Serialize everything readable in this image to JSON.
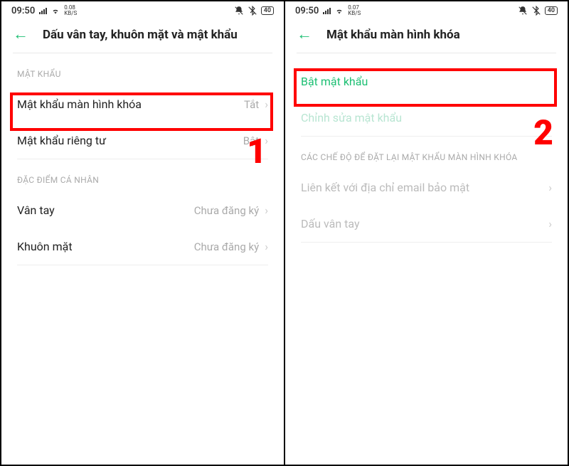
{
  "status": {
    "time": "09:50",
    "kbs1": "0.08",
    "kbs2": "0.07",
    "kbs_unit": "KB/S",
    "battery": "40"
  },
  "screen1": {
    "title": "Dấu vân tay, khuôn mặt và mật khẩu",
    "section1_header": "MẬT KHẨU",
    "item1_label": "Mật khẩu màn hình khóa",
    "item1_value": "Tắt",
    "item2_label": "Mật khẩu riêng tư",
    "item2_value": "Bật",
    "section2_header": "ĐẶC ĐIỂM CÁ NHÂN",
    "item3_label": "Vân tay",
    "item3_value": "Chưa đăng ký",
    "item4_label": "Khuôn mặt",
    "item4_value": "Chưa đăng ký",
    "badge": "1"
  },
  "screen2": {
    "title": "Mật khẩu màn hình khóa",
    "item1_label": "Bật mật khẩu",
    "item2_label": "Chỉnh sửa mật khẩu",
    "section_header": "CÁC CHẾ ĐỘ ĐỂ ĐẶT LẠI MẬT KHẨU MÀN HÌNH KHÓA",
    "item3_label": "Liên kết với địa chỉ email bảo mật",
    "item4_label": "Dấu vân tay",
    "badge": "2"
  }
}
